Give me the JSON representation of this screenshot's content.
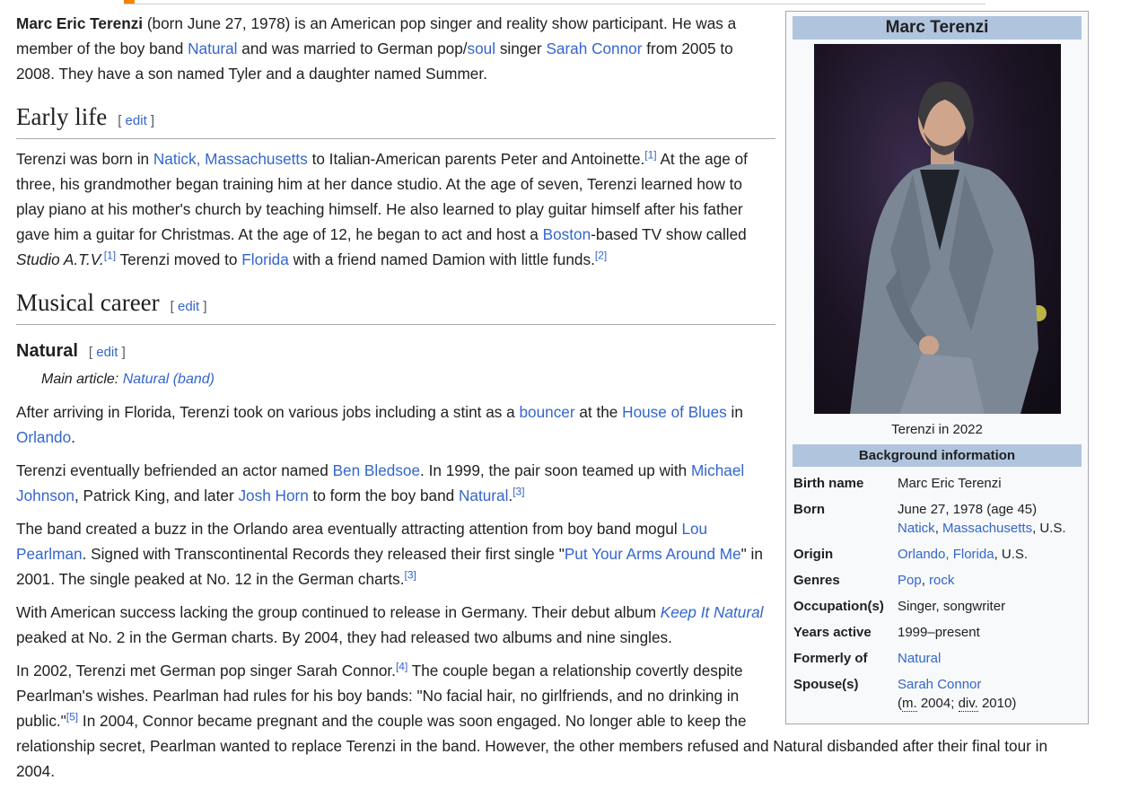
{
  "infobox": {
    "title": "Marc Terenzi",
    "image_caption": "Terenzi in 2022",
    "section_title": "Background information",
    "birth_name_label": "Birth name",
    "birth_name": "Marc Eric Terenzi",
    "born_label": "Born",
    "born_date": "June 27, 1978 (age 45)",
    "born_place_link1": "Natick",
    "born_place_link2": "Massachusetts",
    "born_place_country": ", U.S.",
    "origin_label": "Origin",
    "origin_link": "Orlando, Florida",
    "origin_country": ", U.S.",
    "genres_label": "Genres",
    "genre1": "Pop",
    "genre2": "rock",
    "occupation_label": "Occupation(s)",
    "occupation": "Singer, songwriter",
    "years_label": "Years active",
    "years": "1999–present",
    "formerly_label": "Formerly of",
    "formerly": "Natural",
    "spouse_label": "Spouse(s)",
    "spouse_name": "Sarah Connor",
    "spouse_m_abbr": "m.",
    "spouse_m_year": "2004",
    "spouse_div_abbr": "div.",
    "spouse_div_year": "2010"
  },
  "intro": {
    "subject": "Marc Eric Terenzi",
    "t1": " (born June 27, 1978) is an American pop singer and reality show participant. He was a member of the boy band ",
    "link_natural": "Natural",
    "t2": " and was married to German pop/",
    "link_soul": "soul",
    "t3": " singer ",
    "link_sarah": "Sarah Connor",
    "t4": " from 2005 to 2008. They have a son named Tyler and a daughter named Summer."
  },
  "early_life": {
    "heading": "Early life",
    "edit": "edit",
    "t1": "Terenzi was born in ",
    "link_natick": "Natick, Massachusetts",
    "t2": " to Italian-American parents Peter and Antoinette.",
    "ref1": "[1]",
    "t3": " At the age of three, his grandmother began training him at her dance studio. At the age of seven, Terenzi learned how to play piano at his mother's church by teaching himself. He also learned to play guitar himself after his father gave him a guitar for Christmas. At the age of 12, he began to act and host a ",
    "link_boston": "Boston",
    "t4": "-based TV show called ",
    "show": "Studio A.T.V.",
    "ref2": "[1]",
    "t5": " Terenzi moved to ",
    "link_florida": "Florida",
    "t6": " with a friend named Damion with little funds.",
    "ref3": "[2]"
  },
  "musical_career": {
    "heading": "Musical career",
    "edit": "edit"
  },
  "natural": {
    "heading": "Natural",
    "edit": "edit",
    "hatnote_prefix": "Main article: ",
    "hatnote_link": "Natural (band)",
    "p1": {
      "t1": "After arriving in Florida, Terenzi took on various jobs including a stint as a ",
      "link_bouncer": "bouncer",
      "t2": " at the ",
      "link_hob": "House of Blues",
      "t3": " in ",
      "link_orlando": "Orlando",
      "t4": "."
    },
    "p2": {
      "t1": "Terenzi eventually befriended an actor named ",
      "link_ben": "Ben Bledsoe",
      "t2": ". In 1999, the pair soon teamed up with ",
      "link_michael": "Michael Johnson",
      "t3": ", Patrick King, and later ",
      "link_josh": "Josh Horn",
      "t4": " to form the boy band ",
      "link_natural": "Natural",
      "t5": ".",
      "ref": "[3]"
    },
    "p3": {
      "t1": "The band created a buzz in the Orlando area eventually attracting attention from boy band mogul ",
      "link_lou": "Lou Pearlman",
      "t2": ". Signed with Transcontinental Records they released their first single \"",
      "link_single": "Put Your Arms Around Me",
      "t3": "\" in 2001. The single peaked at No. 12 in the German charts.",
      "ref": "[3]"
    },
    "p4": {
      "t1": "With American success lacking the group continued to release in Germany. Their debut album ",
      "link_album": "Keep It Natural",
      "t2": " peaked at No. 2 in the German charts. By 2004, they had released two albums and nine singles."
    },
    "p5": {
      "t1": "In 2002, Terenzi met German pop singer Sarah Connor.",
      "ref1": "[4]",
      "t2": " The couple began a relationship covertly despite Pearlman's wishes. Pearlman had rules for his boy bands: \"No facial hair, no girlfriends, and no drinking in public.\"",
      "ref2": "[5]",
      "t3": " In 2004, Connor became pregnant and the couple was soon engaged. No longer able to keep the relationship secret, Pearlman wanted to replace Terenzi in the band. However, the other members refused and Natural disbanded after their final tour in 2004."
    }
  }
}
